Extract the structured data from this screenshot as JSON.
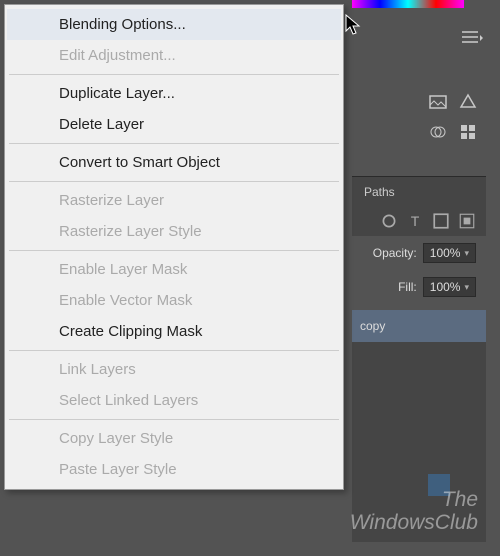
{
  "menu": {
    "items": [
      {
        "label": "Blending Options...",
        "disabled": false,
        "hover": true
      },
      {
        "label": "Edit Adjustment...",
        "disabled": true
      },
      {
        "sep": true
      },
      {
        "label": "Duplicate Layer...",
        "disabled": false
      },
      {
        "label": "Delete Layer",
        "disabled": false
      },
      {
        "sep": true
      },
      {
        "label": "Convert to Smart Object",
        "disabled": false
      },
      {
        "sep": true
      },
      {
        "label": "Rasterize Layer",
        "disabled": true
      },
      {
        "label": "Rasterize Layer Style",
        "disabled": true
      },
      {
        "sep": true
      },
      {
        "label": "Enable Layer Mask",
        "disabled": true
      },
      {
        "label": "Enable Vector Mask",
        "disabled": true
      },
      {
        "label": "Create Clipping Mask",
        "disabled": false
      },
      {
        "sep": true
      },
      {
        "label": "Link Layers",
        "disabled": true
      },
      {
        "label": "Select Linked Layers",
        "disabled": true
      },
      {
        "sep": true
      },
      {
        "label": "Copy Layer Style",
        "disabled": true
      },
      {
        "label": "Paste Layer Style",
        "disabled": true
      }
    ]
  },
  "panel": {
    "tab_paths": "Paths",
    "opacity_label": "Opacity:",
    "opacity_value": "100%",
    "fill_label": "Fill:",
    "fill_value": "100%",
    "layer_name": "copy"
  },
  "watermark": {
    "line1": "The",
    "line2": "WindowsClub"
  }
}
